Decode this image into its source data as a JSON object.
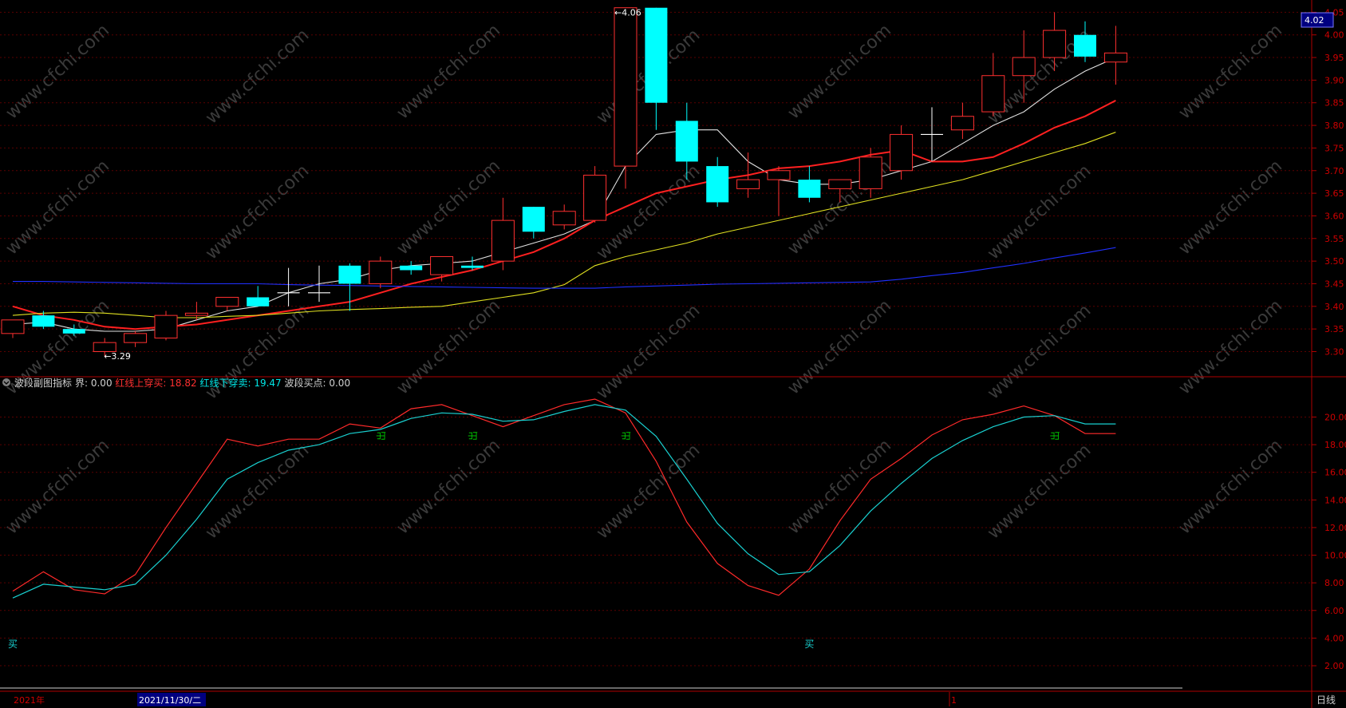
{
  "price_panel": {
    "last_price_tag": "4.02",
    "high_marker": "4.06",
    "low_marker": "3.29"
  },
  "indicator_panel": {
    "title": "波段副图指标",
    "items": [
      {
        "label": "界:",
        "value": "0.00",
        "color": "#d0d0d0"
      },
      {
        "label": "红线上穿买:",
        "value": "18.82",
        "color": "#ff3030"
      },
      {
        "label": "红线下穿卖:",
        "value": "19.47",
        "color": "#00e5e5"
      },
      {
        "label": "波段买点:",
        "value": "0.00",
        "color": "#d0d0d0"
      }
    ],
    "buy_label": "买",
    "sell_label": "出"
  },
  "bottom_bar": {
    "year_label": "2021年",
    "date_label": "2021/11/30/二",
    "marker": "1",
    "period_label": "日线"
  },
  "watermark": "www.cfchi.com",
  "colors": {
    "up": "#ff3030",
    "down": "#00ffff",
    "ma5": "#e0e0e0",
    "ma10": "#ff2020",
    "ma20": "#e0e020",
    "ma60": "#2030ff",
    "grid": "#5a0000",
    "axis": "#b00000"
  },
  "chart_data": [
    {
      "type": "candlestick",
      "yticks": [
        3.3,
        3.35,
        3.4,
        3.45,
        3.5,
        3.55,
        3.6,
        3.65,
        3.7,
        3.75,
        3.8,
        3.85,
        3.9,
        3.95,
        4.0,
        4.05
      ],
      "ylim": [
        3.255,
        4.063
      ],
      "candles": [
        {
          "o": 3.34,
          "h": 3.37,
          "l": 3.33,
          "c": 3.37
        },
        {
          "o": 3.38,
          "h": 3.39,
          "l": 3.35,
          "c": 3.355
        },
        {
          "o": 3.35,
          "h": 3.36,
          "l": 3.335,
          "c": 3.34
        },
        {
          "o": 3.3,
          "h": 3.33,
          "l": 3.29,
          "c": 3.32
        },
        {
          "o": 3.32,
          "h": 3.345,
          "l": 3.31,
          "c": 3.34
        },
        {
          "o": 3.33,
          "h": 3.39,
          "l": 3.325,
          "c": 3.38
        },
        {
          "o": 3.38,
          "h": 3.41,
          "l": 3.37,
          "c": 3.385
        },
        {
          "o": 3.4,
          "h": 3.41,
          "l": 3.39,
          "c": 3.42
        },
        {
          "o": 3.42,
          "h": 3.445,
          "l": 3.4,
          "c": 3.4
        },
        {
          "o": 3.43,
          "h": 3.485,
          "l": 3.4,
          "c": 3.43
        },
        {
          "o": 3.43,
          "h": 3.49,
          "l": 3.41,
          "c": 3.43
        },
        {
          "o": 3.49,
          "h": 3.495,
          "l": 3.39,
          "c": 3.45
        },
        {
          "o": 3.45,
          "h": 3.51,
          "l": 3.44,
          "c": 3.5
        },
        {
          "o": 3.49,
          "h": 3.5,
          "l": 3.47,
          "c": 3.48
        },
        {
          "o": 3.47,
          "h": 3.51,
          "l": 3.455,
          "c": 3.51
        },
        {
          "o": 3.49,
          "h": 3.51,
          "l": 3.48,
          "c": 3.485
        },
        {
          "o": 3.5,
          "h": 3.64,
          "l": 3.48,
          "c": 3.59
        },
        {
          "o": 3.62,
          "h": 3.62,
          "l": 3.55,
          "c": 3.565
        },
        {
          "o": 3.58,
          "h": 3.625,
          "l": 3.57,
          "c": 3.61
        },
        {
          "o": 3.59,
          "h": 3.71,
          "l": 3.585,
          "c": 3.69
        },
        {
          "o": 3.71,
          "h": 4.06,
          "l": 3.66,
          "c": 4.06
        },
        {
          "o": 4.06,
          "h": 4.06,
          "l": 3.79,
          "c": 3.85
        },
        {
          "o": 3.81,
          "h": 3.85,
          "l": 3.68,
          "c": 3.72
        },
        {
          "o": 3.71,
          "h": 3.73,
          "l": 3.62,
          "c": 3.63
        },
        {
          "o": 3.66,
          "h": 3.74,
          "l": 3.64,
          "c": 3.68
        },
        {
          "o": 3.68,
          "h": 3.71,
          "l": 3.6,
          "c": 3.7
        },
        {
          "o": 3.68,
          "h": 3.71,
          "l": 3.63,
          "c": 3.64
        },
        {
          "o": 3.66,
          "h": 3.68,
          "l": 3.63,
          "c": 3.68
        },
        {
          "o": 3.66,
          "h": 3.75,
          "l": 3.64,
          "c": 3.73
        },
        {
          "o": 3.7,
          "h": 3.8,
          "l": 3.68,
          "c": 3.78
        },
        {
          "o": 3.78,
          "h": 3.84,
          "l": 3.72,
          "c": 3.78
        },
        {
          "o": 3.79,
          "h": 3.85,
          "l": 3.77,
          "c": 3.82
        },
        {
          "o": 3.83,
          "h": 3.96,
          "l": 3.82,
          "c": 3.91
        },
        {
          "o": 3.91,
          "h": 4.01,
          "l": 3.85,
          "c": 3.95
        },
        {
          "o": 3.95,
          "h": 4.05,
          "l": 3.92,
          "c": 4.01
        },
        {
          "o": 4.0,
          "h": 4.03,
          "l": 3.94,
          "c": 3.952
        },
        {
          "o": 3.94,
          "h": 4.02,
          "l": 3.89,
          "c": 3.96
        }
      ],
      "ma_lines": [
        {
          "name": "MA5",
          "color": "#e0e0e0",
          "values": [
            3.36,
            3.365,
            3.35,
            3.345,
            3.345,
            3.35,
            3.37,
            3.39,
            3.4,
            3.43,
            3.45,
            3.46,
            3.48,
            3.49,
            3.495,
            3.5,
            3.52,
            3.54,
            3.56,
            3.59,
            3.71,
            3.78,
            3.79,
            3.79,
            3.72,
            3.68,
            3.67,
            3.67,
            3.68,
            3.7,
            3.72,
            3.76,
            3.8,
            3.83,
            3.88,
            3.92,
            3.95
          ]
        },
        {
          "name": "MA10",
          "color": "#ff2020",
          "values": [
            3.4,
            3.38,
            3.37,
            3.355,
            3.35,
            3.355,
            3.36,
            3.37,
            3.38,
            3.39,
            3.4,
            3.41,
            3.43,
            3.45,
            3.465,
            3.48,
            3.5,
            3.52,
            3.55,
            3.59,
            3.62,
            3.65,
            3.665,
            3.68,
            3.69,
            3.705,
            3.71,
            3.72,
            3.735,
            3.745,
            3.72,
            3.72,
            3.73,
            3.76,
            3.795,
            3.82,
            3.855
          ]
        },
        {
          "name": "MA20",
          "color": "#e0e020",
          "values": [
            3.38,
            3.385,
            3.387,
            3.385,
            3.38,
            3.375,
            3.375,
            3.378,
            3.38,
            3.385,
            3.39,
            3.393,
            3.395,
            3.398,
            3.4,
            3.41,
            3.42,
            3.43,
            3.448,
            3.49,
            3.51,
            3.525,
            3.54,
            3.56,
            3.575,
            3.59,
            3.605,
            3.62,
            3.635,
            3.65,
            3.665,
            3.68,
            3.7,
            3.72,
            3.74,
            3.76,
            3.785
          ]
        },
        {
          "name": "MA60",
          "color": "#2030ff",
          "values": [
            3.455,
            3.455,
            3.454,
            3.453,
            3.452,
            3.451,
            3.45,
            3.45,
            3.45,
            3.448,
            3.447,
            3.446,
            3.445,
            3.444,
            3.443,
            3.442,
            3.441,
            3.44,
            3.44,
            3.44,
            3.443,
            3.445,
            3.447,
            3.449,
            3.45,
            3.451,
            3.452,
            3.453,
            3.454,
            3.46,
            3.468,
            3.475,
            3.485,
            3.495,
            3.507,
            3.518,
            3.53
          ]
        }
      ]
    },
    {
      "type": "line",
      "yticks": [
        2,
        4,
        6,
        8,
        10,
        12,
        14,
        16,
        18,
        20
      ],
      "ytick_labels": [
        "2.00",
        "4.00",
        "6.00",
        "8.00",
        "10.00",
        "12.00",
        "14.00",
        "16.00",
        "18.00",
        "20.00"
      ],
      "ylim": [
        0.5,
        22.8
      ],
      "x": [
        0,
        1,
        2,
        3,
        4,
        5,
        6,
        7,
        8,
        9,
        10,
        11,
        12,
        13,
        14,
        15,
        16,
        17,
        18,
        19,
        20,
        21,
        22,
        23,
        24,
        25,
        26,
        27,
        28,
        29,
        30,
        31,
        32,
        33,
        34,
        35,
        36
      ],
      "series": [
        {
          "name": "红线",
          "color": "#ff2a2a",
          "values": [
            7.4,
            8.8,
            7.5,
            7.2,
            8.6,
            12.0,
            15.2,
            18.4,
            17.9,
            18.4,
            18.4,
            19.5,
            19.2,
            20.6,
            20.9,
            20.1,
            19.3,
            20.1,
            20.9,
            21.3,
            20.3,
            16.8,
            12.4,
            9.4,
            7.8,
            7.1,
            9.0,
            12.5,
            15.5,
            17.0,
            18.7,
            19.8,
            20.2,
            20.8,
            20.1,
            18.8,
            18.8
          ]
        },
        {
          "name": "蓝线",
          "color": "#19d0d0",
          "values": [
            6.9,
            7.9,
            7.7,
            7.5,
            7.9,
            10.0,
            12.6,
            15.5,
            16.7,
            17.6,
            18.0,
            18.8,
            19.1,
            19.9,
            20.3,
            20.2,
            19.7,
            19.8,
            20.4,
            20.9,
            20.5,
            18.6,
            15.5,
            12.3,
            10.1,
            8.6,
            8.8,
            10.7,
            13.2,
            15.2,
            17.0,
            18.3,
            19.3,
            20.0,
            20.1,
            19.5,
            19.5
          ]
        }
      ],
      "buy_points": [
        0,
        26
      ],
      "sell_points": [
        12,
        15,
        20,
        34
      ]
    }
  ]
}
